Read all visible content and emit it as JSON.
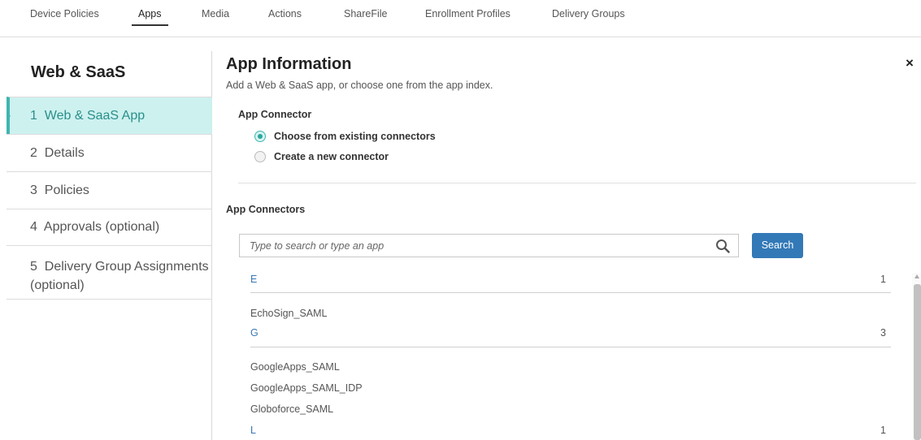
{
  "topnav": {
    "tabs": [
      {
        "label": "Device Policies"
      },
      {
        "label": "Apps",
        "active": true
      },
      {
        "label": "Media"
      },
      {
        "label": "Actions"
      },
      {
        "label": "ShareFile"
      },
      {
        "label": "Enrollment Profiles"
      },
      {
        "label": "Delivery Groups"
      }
    ]
  },
  "sidebar": {
    "title": "Web & SaaS",
    "steps": [
      {
        "label": "1  Web & SaaS App",
        "active": true
      },
      {
        "label": "2  Details"
      },
      {
        "label": "3  Policies"
      },
      {
        "label": "4  Approvals (optional)"
      },
      {
        "label": "5  Delivery Group Assignments (optional)"
      }
    ]
  },
  "main": {
    "title": "App Information",
    "subtitle": "Add a Web & SaaS app, or choose one from the app index.",
    "close_glyph": "×",
    "app_connector_label": "App Connector",
    "radio_options": [
      {
        "label": "Choose from existing connectors",
        "selected": true
      },
      {
        "label": "Create a new connector",
        "selected": false
      }
    ],
    "app_connectors_label": "App Connectors",
    "search": {
      "placeholder": "Type to search or type an app",
      "value": "",
      "button_label": "Search"
    },
    "groups": [
      {
        "letter": "E",
        "count": "1",
        "items": [
          "EchoSign_SAML"
        ]
      },
      {
        "letter": "G",
        "count": "3",
        "items": [
          "GoogleApps_SAML",
          "GoogleApps_SAML_IDP",
          "Globoforce_SAML"
        ]
      },
      {
        "letter": "L",
        "count": "1",
        "items": []
      }
    ]
  },
  "colors": {
    "accent_teal": "#3fb5ae",
    "active_step_bg": "#cdf1ef",
    "link_blue": "#3a78b5",
    "search_button": "#3379b7"
  }
}
